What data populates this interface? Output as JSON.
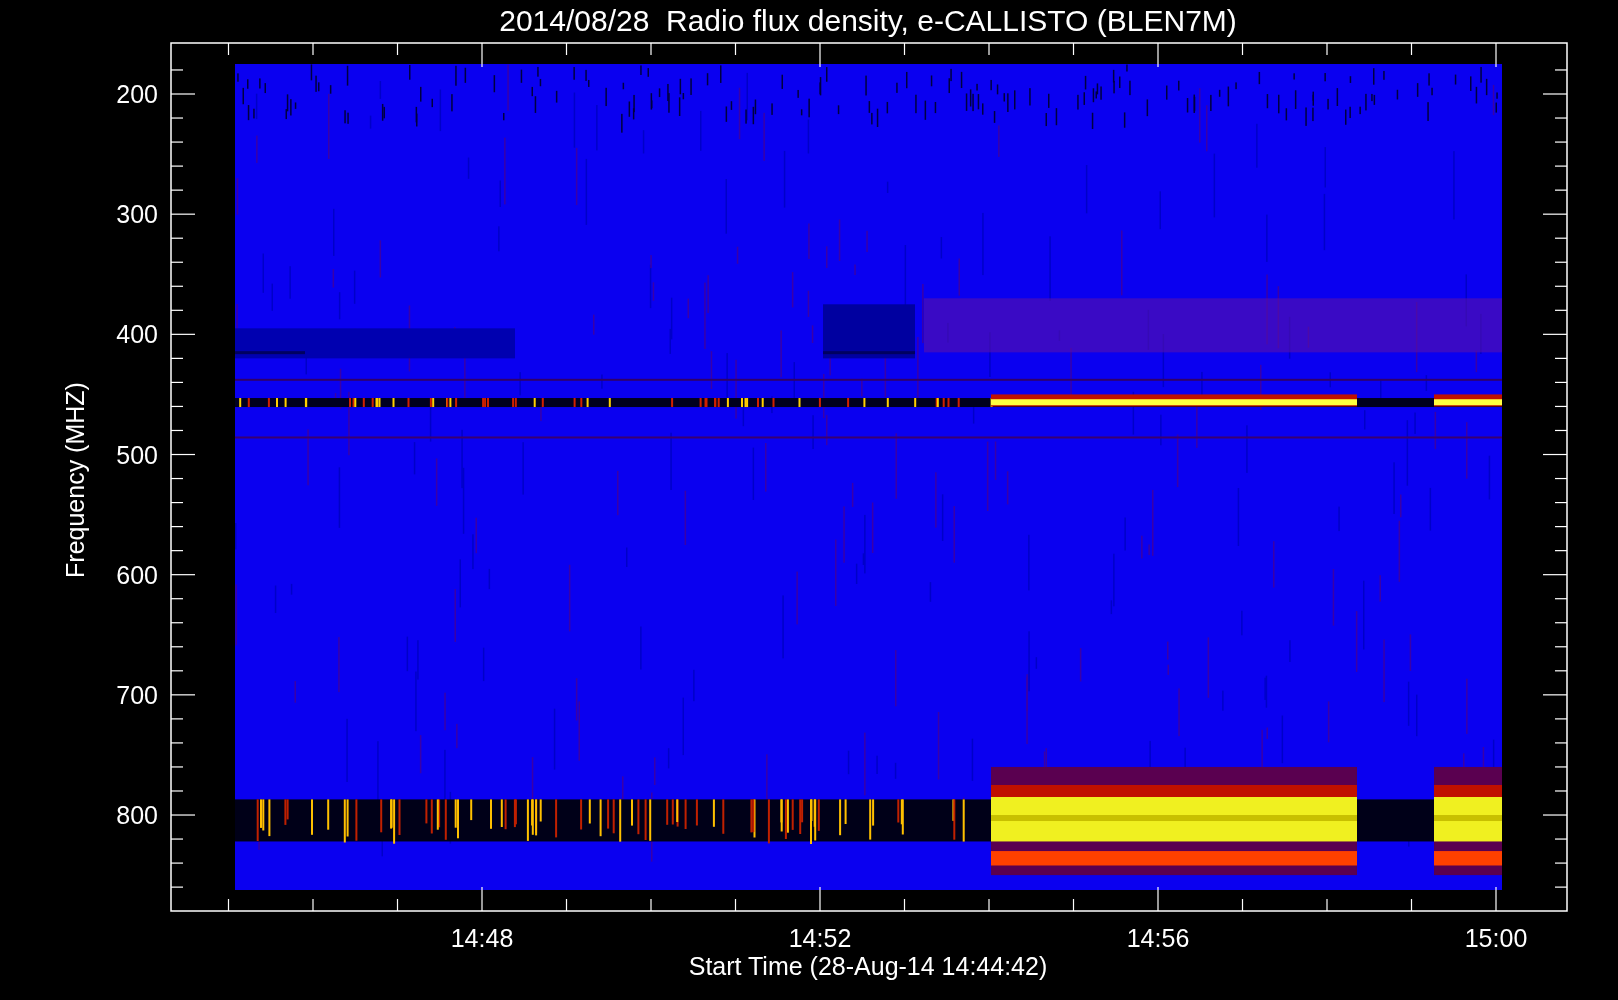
{
  "title": "2014/08/28  Radio flux density, e-CALLISTO (BLEN7M)",
  "ylabel": "Frequency (MHZ)",
  "xlabel": "Start Time (28-Aug-14 14:44:42)",
  "y_tick_labels": [
    "200",
    "300",
    "400",
    "500",
    "600",
    "700",
    "800"
  ],
  "x_tick_labels": [
    "14:48",
    "14:52",
    "14:56",
    "15:00"
  ]
}
